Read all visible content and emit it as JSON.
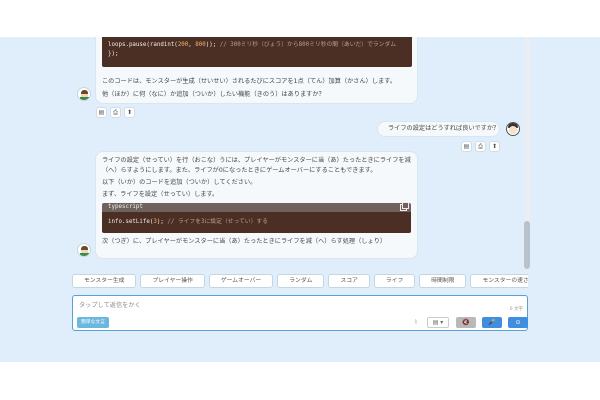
{
  "messages": {
    "bot1": {
      "code_lines": [
        {
          "code": "    loops.pause(randint(",
          "n1": "200",
          "sep": ", ",
          "n2": "800",
          "end": "));",
          "comment": " // 300ミリ秒（びょう）から800ミリ秒の間（あいだ）でランダム"
        },
        {
          "code": "});",
          "comment": ""
        }
      ],
      "paragraphs": [
        "このコードは、モンスターが生成（せいせい）されるたびにスコアを1点（てん）加算（かさん）します。",
        "他（ほか）に何（なに）か追加（ついか）したい機能（きのう）はありますか？"
      ]
    },
    "user1": {
      "text": "ライフの設定はどうすれば良いですか？"
    },
    "bot2": {
      "paragraphs_before": [
        "ライフの設定（せってい）を行（おこな）うには、プレイヤーがモンスターに当（あ）たったときにライフを減",
        "（へ）らすようにします。また、ライフが0になったときにゲームオーバーにすることもできます。",
        "以下（いか）のコードを追加（ついか）してください。",
        "まず、ライフを設定（せってい）します。"
      ],
      "code_lang": "typescript",
      "code": {
        "text": "info.setLife(",
        "num": "3",
        "end": ");",
        "comment": " // ライフを3に設定（せってい）する"
      },
      "paragraph_after": "次（つぎ）に、プレイヤーがモンスターに当（あ）たったときにライフを減（へ）らす処理（しょり）"
    }
  },
  "actions": {
    "copy": "▤",
    "print": "⎙",
    "share": "⬆"
  },
  "chips": [
    "モンスター生成",
    "プレイヤー操作",
    "ゲームオーバー",
    "ランダム",
    "スコア",
    "ライフ",
    "時間制限",
    "モンスターの速さをランダム"
  ],
  "composer": {
    "placeholder": "タップして返信をかく",
    "char_count": "0 文字",
    "mode_badge": "簡単な文言",
    "select_label": "▤ ▾",
    "clip_icon": "⌇",
    "mute_icon": "🔇",
    "mic_icon": "🎤",
    "send_icon": "⊙"
  },
  "colors": {
    "background": "#dfeefa",
    "code_bg": "#4b2f25",
    "accent": "#3f8ee0"
  }
}
